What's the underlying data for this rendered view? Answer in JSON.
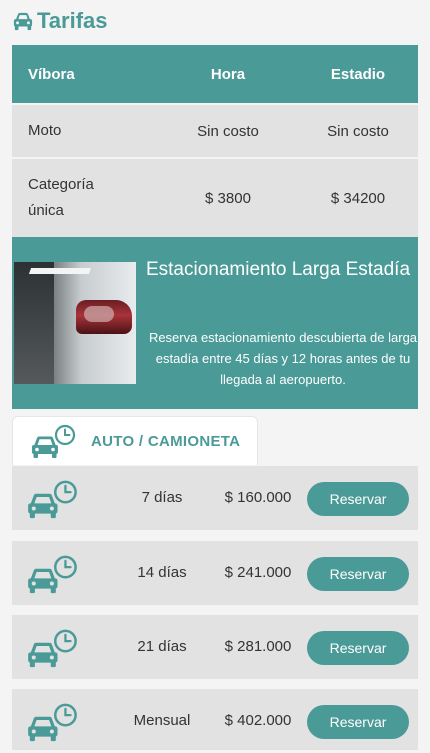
{
  "header": {
    "title": "Tarifas",
    "icon": "car-icon"
  },
  "rates_table": {
    "headers": [
      "Víbora",
      "Hora",
      "Estadio"
    ],
    "rows": [
      {
        "name": "Moto",
        "hora": "Sin costo",
        "estadio": "Sin costo"
      },
      {
        "name": "Categoría única",
        "hora": "$ 3800",
        "estadio": "$ 34200"
      }
    ]
  },
  "promo": {
    "title": "Estacionamiento Larga Estadía",
    "description": "Reserva estacionamiento descubierta de larga estadía entre 45 días y 12 horas antes de tu llegada al aeropuerto.",
    "image": "car-taillight-photo"
  },
  "tab": {
    "label": "AUTO / CAMIONETA",
    "icon": "car-clock-icon"
  },
  "options": [
    {
      "days": "7 días",
      "price": "$ 160.000",
      "button": "Reservar"
    },
    {
      "days": "14 días",
      "price": "$ 241.000",
      "button": "Reservar"
    },
    {
      "days": "21 días",
      "price": "$ 281.000",
      "button": "Reservar"
    },
    {
      "days": "Mensual",
      "price": "$ 402.000",
      "button": "Reservar"
    }
  ],
  "colors": {
    "accent": "#4a9a98",
    "row_bg": "#e2e2e2",
    "page_bg": "#f4f4f4"
  }
}
